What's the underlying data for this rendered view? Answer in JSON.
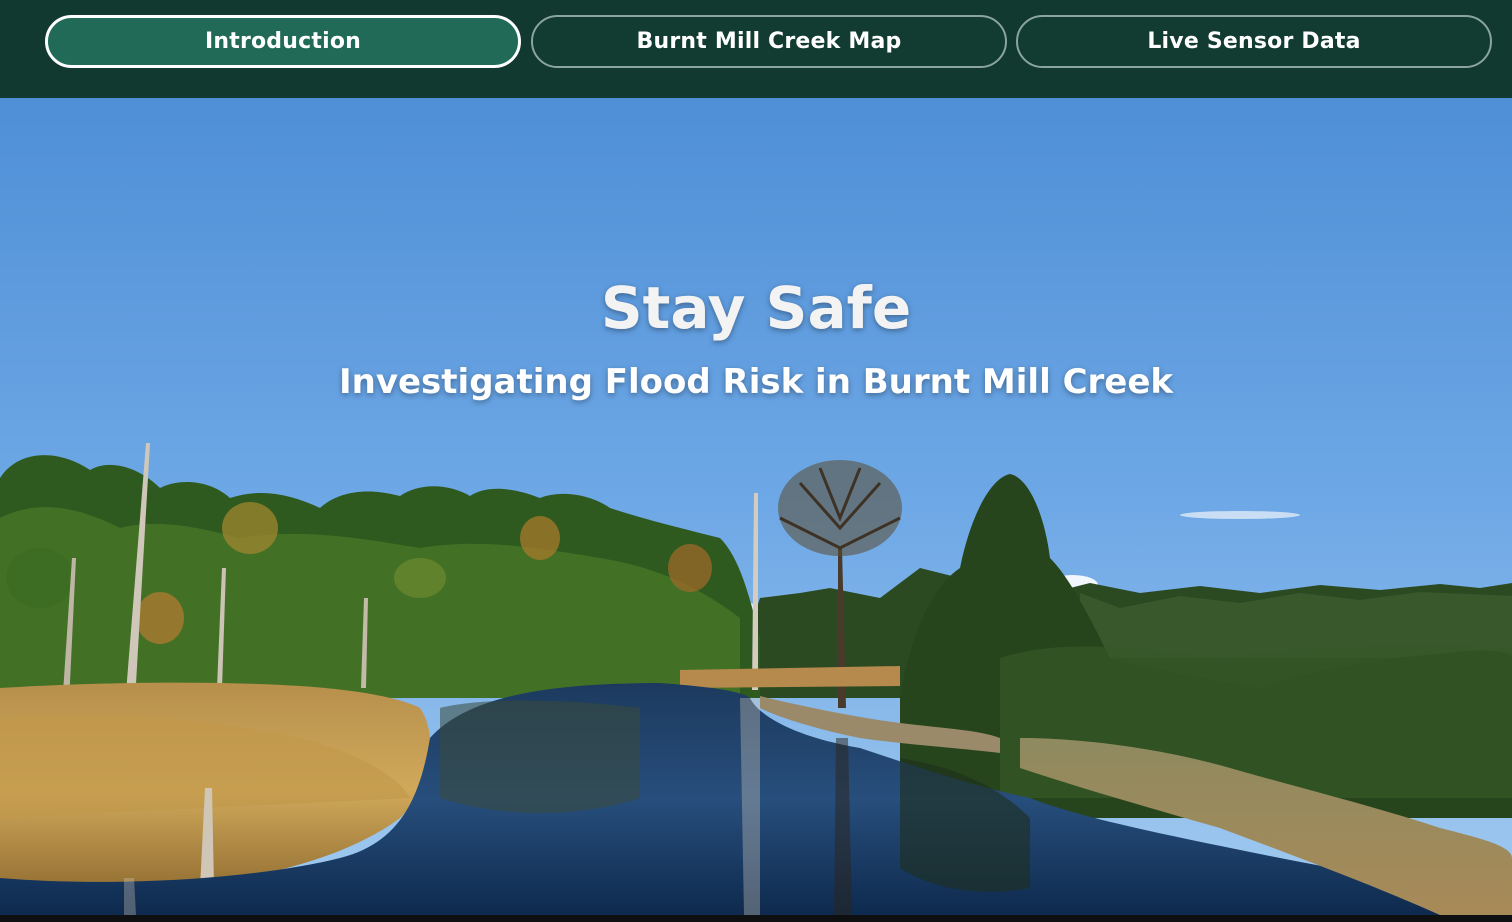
{
  "nav": {
    "items": [
      {
        "label": "Introduction",
        "active": true
      },
      {
        "label": "Burnt Mill Creek Map",
        "active": false
      },
      {
        "label": "Live Sensor Data",
        "active": false
      }
    ]
  },
  "hero": {
    "title": "Stay Safe",
    "subtitle": "Investigating Flood Risk in Burnt Mill Creek"
  },
  "colors": {
    "nav_bg": "#12392f",
    "nav_button_active": "#206a57",
    "nav_button": "#123b31",
    "sky_top": "#4f8fd6",
    "sky_horizon": "#9cc5ee",
    "water": "#0e2a4e",
    "marsh_grass": "#c59a4a",
    "forest": "#2f5a1f"
  }
}
